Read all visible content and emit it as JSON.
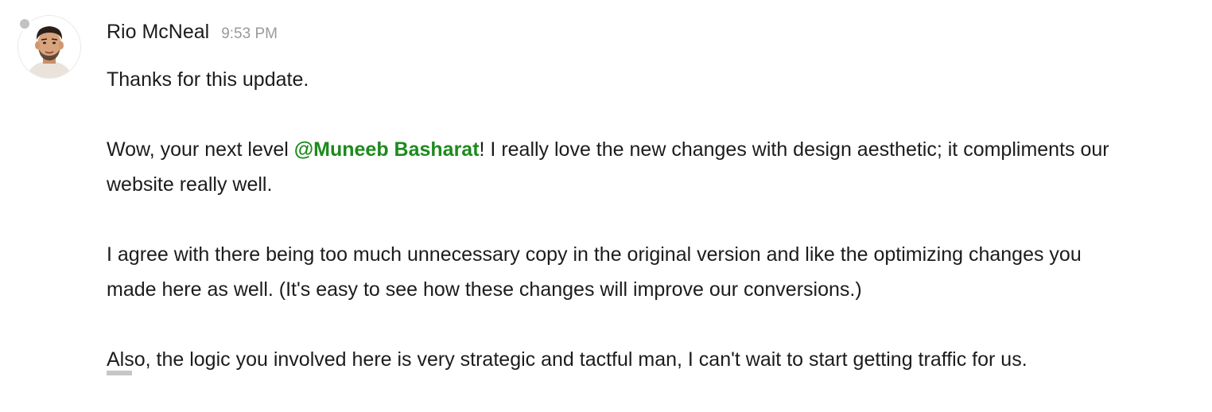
{
  "message": {
    "author": "Rio McNeal",
    "timestamp": "9:53 PM",
    "avatar_icon": "user-avatar-photo",
    "presence": "away",
    "paragraphs": [
      {
        "text": "Thanks for this update."
      },
      {
        "before": "Wow, your next level ",
        "mention": "@Muneeb Basharat",
        "after": "! I really love the new changes with design aesthetic; it compliments our website really well."
      },
      {
        "text": "I agree with there being too much unnecessary copy in the original version and like the optimizing changes you made here as well. (It's easy to see how these changes will improve our conversions.)"
      },
      {
        "text": "Also, the logic you involved here is very strategic and tactful man, I can't wait to start getting traffic for us."
      }
    ]
  },
  "colors": {
    "mention": "#1d8a1d",
    "text": "#1d1c1d",
    "timestamp": "#9a9a9a",
    "presence_dot": "#c2c2c2"
  }
}
